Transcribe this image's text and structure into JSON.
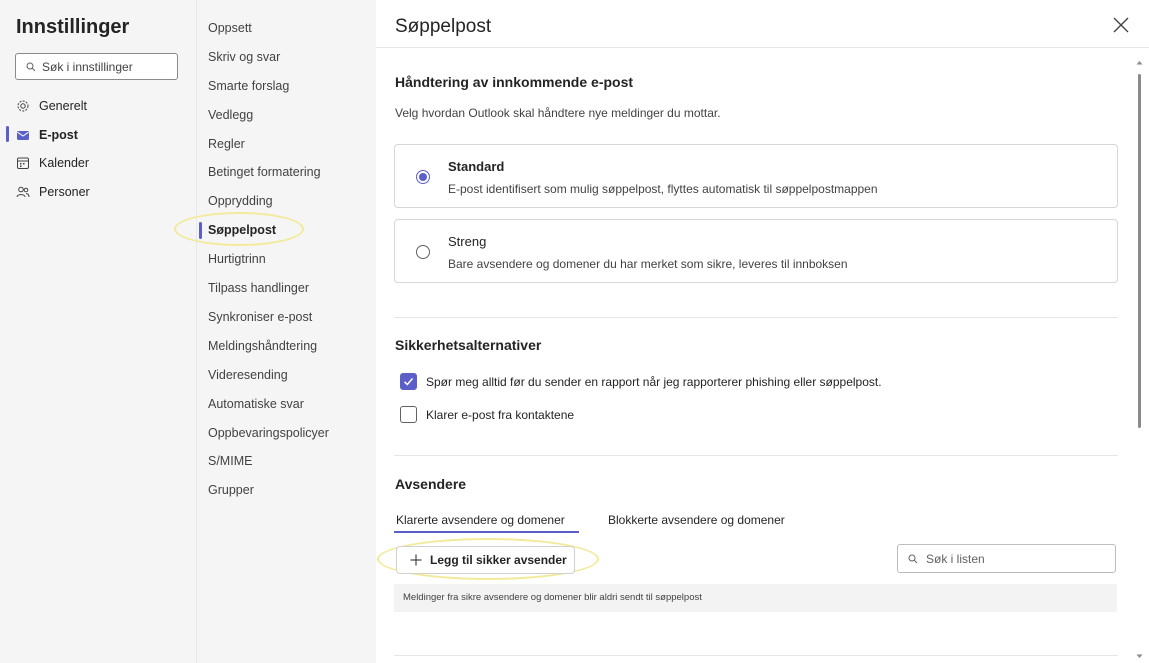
{
  "left": {
    "title": "Innstillinger",
    "search_placeholder": "Søk i innstillinger",
    "categories": [
      {
        "label": "Generelt",
        "icon": "gear-icon"
      },
      {
        "label": "E-post",
        "icon": "mail-icon"
      },
      {
        "label": "Kalender",
        "icon": "calendar-icon"
      },
      {
        "label": "Personer",
        "icon": "people-icon"
      }
    ]
  },
  "middle": {
    "items": [
      "Oppsett",
      "Skriv og svar",
      "Smarte forslag",
      "Vedlegg",
      "Regler",
      "Betinget formatering",
      "Opprydding",
      "Søppelpost",
      "Hurtigtrinn",
      "Tilpass handlinger",
      "Synkroniser e-post",
      "Meldingshåndtering",
      "Videresending",
      "Automatiske svar",
      "Oppbevaringspolicyer",
      "S/MIME",
      "Grupper"
    ],
    "active_index": 7
  },
  "main": {
    "title": "Søppelpost",
    "incoming": {
      "heading": "Håndtering av innkommende e-post",
      "description": "Velg hvordan Outlook skal håndtere nye meldinger du mottar.",
      "options": [
        {
          "title": "Standard",
          "desc": "E-post identifisert som mulig søppelpost, flyttes automatisk til søppelpostmappen",
          "selected": true
        },
        {
          "title": "Streng",
          "desc": "Bare avsendere og domener du har merket som sikre, leveres til innboksen",
          "selected": false
        }
      ]
    },
    "security": {
      "heading": "Sikkerhetsalternativer",
      "options": [
        {
          "label": "Spør meg alltid før du sender en rapport når jeg rapporterer phishing eller søppelpost.",
          "checked": true
        },
        {
          "label": "Klarer e-post fra kontaktene",
          "checked": false
        }
      ]
    },
    "senders": {
      "heading": "Avsendere",
      "tabs": [
        "Klarerte avsendere og domener",
        "Blokkerte avsendere og domener"
      ],
      "add_button": "Legg til sikker avsender",
      "search_placeholder": "Søk i listen",
      "info": "Meldinger fra sikre avsendere og domener blir aldri sendt til søppelpost"
    }
  },
  "colors": {
    "accent": "#5b5fc7",
    "highlight": "#f2ea9a",
    "pane_bg": "#f5f5f5"
  }
}
